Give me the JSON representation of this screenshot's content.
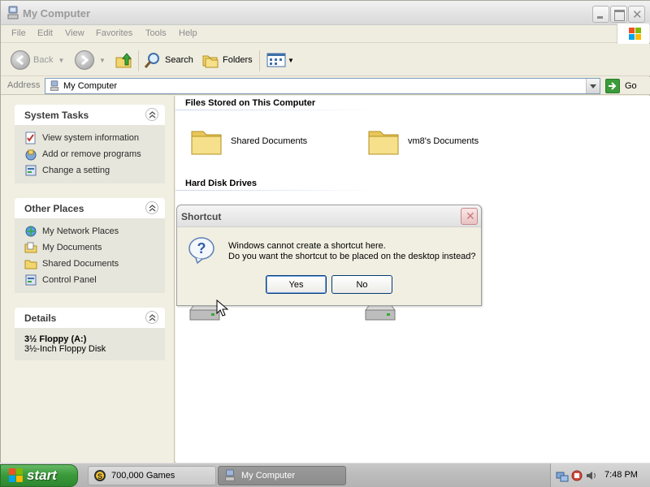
{
  "window": {
    "title": "My Computer",
    "menu": [
      "File",
      "Edit",
      "View",
      "Favorites",
      "Tools",
      "Help"
    ]
  },
  "toolbar": {
    "back_label": "Back",
    "search_label": "Search",
    "folders_label": "Folders"
  },
  "address": {
    "label": "Address",
    "value": "My Computer",
    "go_label": "Go"
  },
  "sidebar": {
    "system_tasks": {
      "title": "System Tasks",
      "items": [
        {
          "label": "View system information",
          "icon": "system-info-icon"
        },
        {
          "label": "Add or remove programs",
          "icon": "add-remove-programs-icon"
        },
        {
          "label": "Change a setting",
          "icon": "control-panel-icon"
        }
      ]
    },
    "other_places": {
      "title": "Other Places",
      "items": [
        {
          "label": "My Network Places",
          "icon": "network-places-icon"
        },
        {
          "label": "My Documents",
          "icon": "my-documents-icon"
        },
        {
          "label": "Shared Documents",
          "icon": "folder-icon"
        },
        {
          "label": "Control Panel",
          "icon": "control-panel-icon"
        }
      ]
    },
    "details": {
      "title": "Details",
      "name": "3½ Floppy (A:)",
      "description": "3½-Inch Floppy Disk"
    }
  },
  "main": {
    "files_group": {
      "title": "Files Stored on This Computer",
      "items": [
        "Shared Documents",
        "vm8's Documents"
      ]
    },
    "drives_group": {
      "title": "Hard Disk Drives"
    }
  },
  "dialog": {
    "title": "Shortcut",
    "line1": "Windows cannot create a shortcut here.",
    "line2": "Do you want the shortcut to be placed on the desktop instead?",
    "yes_label": "Yes",
    "no_label": "No"
  },
  "taskbar": {
    "start_label": "start",
    "tasks": [
      "700,000 Games",
      "My Computer"
    ],
    "clock": "7:48 PM"
  }
}
